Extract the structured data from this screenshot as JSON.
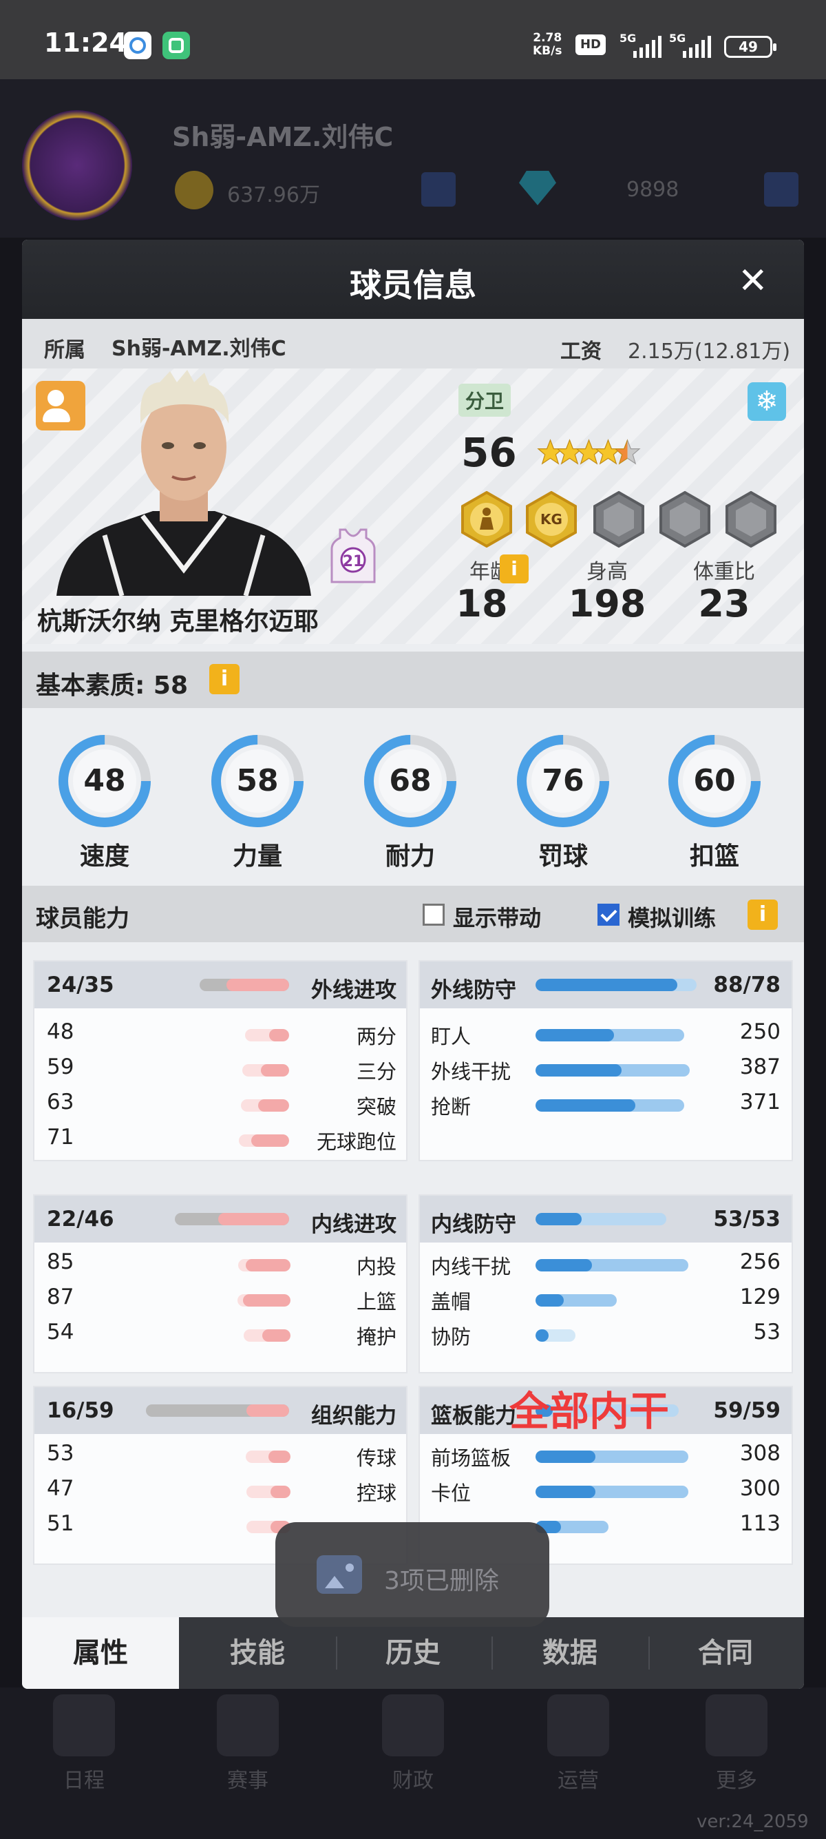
{
  "status_bar": {
    "time": "11:24",
    "speed_value": "2.78",
    "speed_unit": "KB/s",
    "hd": "HD",
    "sig1": "5G",
    "sig2": "5G",
    "battery": "49"
  },
  "background": {
    "team_name": "Sh弱-AMZ.刘伟C",
    "coins": "637.96万",
    "gems": "9898",
    "nav": [
      "日程",
      "赛事",
      "财政",
      "运营",
      "更多"
    ],
    "version": "ver:24_2059"
  },
  "dialog": {
    "title": "球员信息",
    "close": "✕",
    "team_label": "所属",
    "team_value": "Sh弱-AMZ.刘伟C",
    "salary_label": "工资",
    "salary_value": "2.15万(12.81万)",
    "player": {
      "name": "杭斯沃尔纳 克里格尔迈耶",
      "position": "分卫",
      "overall": "56",
      "stars": 4.5,
      "jersey": "21",
      "badge_kg": "KG",
      "age_label": "年龄",
      "age": "18",
      "height_label": "身高",
      "height": "198",
      "weight_label": "体重比",
      "weight": "23",
      "info": "i",
      "freeze_icon": "snowflake-icon",
      "edit_icon": "user-edit-icon"
    },
    "basic": {
      "label": "基本素质: 58",
      "info": "i",
      "stats": [
        {
          "label": "速度",
          "value": "48",
          "fill": 0.75
        },
        {
          "label": "力量",
          "value": "58",
          "fill": 0.75
        },
        {
          "label": "耐力",
          "value": "68",
          "fill": 0.75
        },
        {
          "label": "罚球",
          "value": "76",
          "fill": 0.75
        },
        {
          "label": "扣篮",
          "value": "60",
          "fill": 0.75
        }
      ]
    },
    "abilities": {
      "label": "球员能力",
      "toggle1": "显示带动",
      "toggle1_checked": false,
      "toggle2": "模拟训练",
      "toggle2_checked": true,
      "info": "i",
      "groups": [
        {
          "title": "外线进攻",
          "value": "24/35",
          "side": "left",
          "fill": 0.69,
          "rows": [
            {
              "label": "两分",
              "value": "48",
              "fill": 0.45
            },
            {
              "label": "三分",
              "value": "59",
              "fill": 0.6
            },
            {
              "label": "突破",
              "value": "63",
              "fill": 0.65
            },
            {
              "label": "无球跑位",
              "value": "71",
              "fill": 0.75
            }
          ]
        },
        {
          "title": "外线防守",
          "value": "88/78",
          "side": "right",
          "fill": 0.88,
          "rows": [
            {
              "label": "盯人",
              "value": "250",
              "fill": 0.52
            },
            {
              "label": "外线干扰",
              "value": "387",
              "fill": 0.58
            },
            {
              "label": "抢断",
              "value": "371",
              "fill": 0.82
            }
          ]
        },
        {
          "title": "内线进攻",
          "value": "22/46",
          "side": "left",
          "fill": 0.48,
          "rows": [
            {
              "label": "内投",
              "value": "85",
              "fill": 0.85
            },
            {
              "label": "上篮",
              "value": "87",
              "fill": 0.9
            },
            {
              "label": "掩护",
              "value": "54",
              "fill": 0.6
            }
          ]
        },
        {
          "title": "内线防守",
          "value": "53/53",
          "side": "right",
          "fill": 0.35,
          "rows": [
            {
              "label": "内线干扰",
              "value": "256",
              "fill": 0.15
            },
            {
              "label": "盖帽",
              "value": "129",
              "fill": 0.1
            },
            {
              "label": "协防",
              "value": "53",
              "fill": 0.05
            }
          ]
        },
        {
          "title": "组织能力",
          "value": "16/59",
          "side": "left",
          "fill": 0.27,
          "rows": [
            {
              "label": "传球",
              "value": "53",
              "fill": 0.5
            },
            {
              "label": "控球",
              "value": "47",
              "fill": 0.45
            },
            {
              "label": "",
              "value": "51",
              "fill": 0.45
            }
          ]
        },
        {
          "title": "篮板能力",
          "value": "59/59",
          "side": "right",
          "fill": 0.12,
          "rows": [
            {
              "label": "前场篮板",
              "value": "308",
              "fill": 0.2
            },
            {
              "label": "卡位",
              "value": "300",
              "fill": 0.2
            },
            {
              "label": "",
              "value": "113",
              "fill": 0.1
            }
          ]
        }
      ]
    },
    "annotation": "全部内干",
    "tabs": [
      "属性",
      "技能",
      "历史",
      "数据",
      "合同"
    ]
  },
  "toast": {
    "text": "3项已删除",
    "icon": "gallery-icon"
  },
  "colors": {
    "blue_fill": "#3b8fd8",
    "blue_light": "#8cc3ef",
    "pink_fill": "#f3a9a9",
    "gray_track": "#b8b8b8",
    "gold": "#f2b21b",
    "annotation": "#ee3b3b"
  }
}
